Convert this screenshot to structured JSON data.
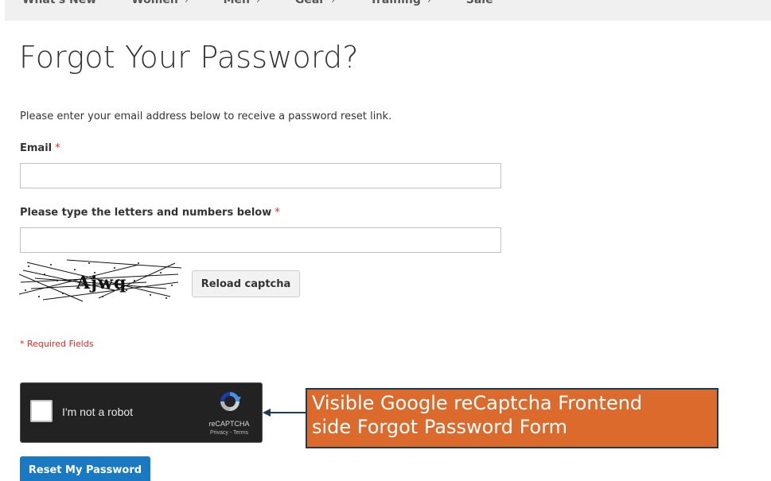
{
  "nav": {
    "items": [
      {
        "label": "What's New",
        "chevron": ""
      },
      {
        "label": "Women",
        "chevron": "›"
      },
      {
        "label": "Men",
        "chevron": "›"
      },
      {
        "label": "Gear",
        "chevron": "›"
      },
      {
        "label": "Training",
        "chevron": "›"
      },
      {
        "label": "Sale",
        "chevron": ""
      }
    ]
  },
  "page": {
    "title": "Forgot Your Password?",
    "intro": "Please enter your email address below to receive a password reset link."
  },
  "form": {
    "email_label": "Email",
    "email_value": "",
    "captcha_label": "Please type the letters and numbers below",
    "captcha_value": "",
    "required_mark": "*",
    "captcha_text": "Ajwq",
    "reload_label": "Reload captcha",
    "required_note": "* Required Fields",
    "submit_label": "Reset My Password"
  },
  "recaptcha": {
    "checkbox_label": "I'm not a robot",
    "brand": "reCAPTCHA",
    "privacy": "Privacy",
    "separator": " - ",
    "terms": "Terms"
  },
  "callout": {
    "line1": "Visible Google reCaptcha Frontend",
    "line2": "side Forgot Password Form"
  },
  "colors": {
    "primary_button": "#1979c3",
    "required": "#e02b27",
    "callout_bg": "#dc6a2c",
    "callout_border": "#1f3a4e",
    "recaptcha_bg": "#222222"
  }
}
